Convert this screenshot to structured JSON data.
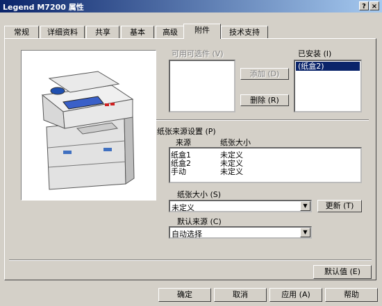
{
  "window": {
    "title": "Legend M7200 属性",
    "help_glyph": "?",
    "close_glyph": "×"
  },
  "tabs": [
    {
      "label": "常规"
    },
    {
      "label": "详细资料"
    },
    {
      "label": "共享"
    },
    {
      "label": "基本"
    },
    {
      "label": "高级"
    },
    {
      "label": "附件"
    },
    {
      "label": "技术支持"
    }
  ],
  "active_tab": "附件",
  "available": {
    "label": "可用可选件 (V)",
    "items": []
  },
  "installed": {
    "label": "已安装 (I)",
    "items": [
      "(纸盒2)"
    ]
  },
  "buttons": {
    "add": "添加 (D)",
    "remove": "删除 (R)",
    "update": "更新 (T)",
    "defaults": "默认值 (E)"
  },
  "paper_source": {
    "label": "纸张来源设置 (P)",
    "headers": [
      "来源",
      "纸张大小"
    ],
    "rows": [
      [
        "纸盒1",
        "未定义"
      ],
      [
        "纸盒2",
        "未定义"
      ],
      [
        "手动",
        "未定义"
      ]
    ]
  },
  "paper_size": {
    "label": "纸张大小 (S)",
    "value": "未定义"
  },
  "default_source": {
    "label": "默认来源 (C)",
    "value": "自动选择"
  },
  "footer": {
    "ok": "确定",
    "cancel": "取消",
    "apply": "应用 (A)",
    "help": "帮助"
  }
}
